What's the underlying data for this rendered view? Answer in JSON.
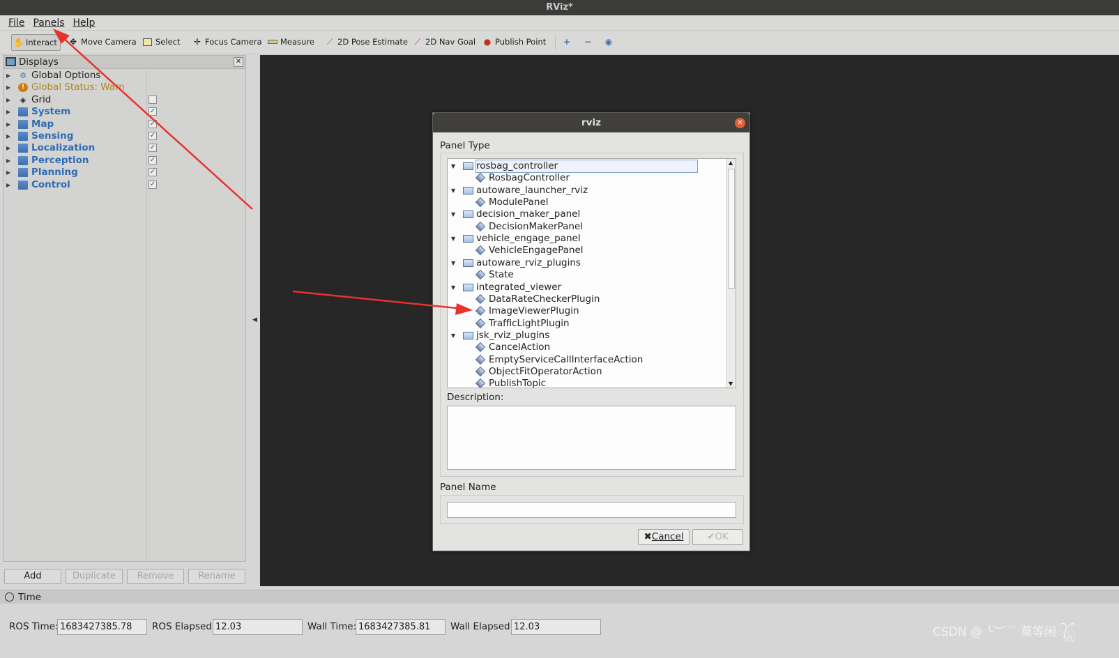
{
  "window": {
    "title": "RViz*"
  },
  "menu": [
    "File",
    "Panels",
    "Help"
  ],
  "toolbar": {
    "tools": [
      {
        "label": "Interact",
        "icon": "hand-icon",
        "active": true
      },
      {
        "label": "Move Camera",
        "icon": "move-camera-icon"
      },
      {
        "label": "Select",
        "icon": "select-icon"
      },
      {
        "label": "Focus Camera",
        "icon": "focus-camera-icon"
      },
      {
        "label": "Measure",
        "icon": "measure-icon"
      },
      {
        "label": "2D Pose Estimate",
        "icon": "pose-estimate-icon"
      },
      {
        "label": "2D Nav Goal",
        "icon": "nav-goal-icon"
      },
      {
        "label": "Publish Point",
        "icon": "publish-point-icon"
      }
    ]
  },
  "displays": {
    "title": "Displays",
    "items": [
      {
        "label": "Global Options",
        "icon": "gear-icon",
        "style": "normal",
        "checkbox": null
      },
      {
        "label": "Global Status: Warn",
        "icon": "warning-icon",
        "style": "warn",
        "checkbox": null
      },
      {
        "label": "Grid",
        "icon": "grid-icon",
        "style": "normal",
        "checkbox": "unchecked"
      },
      {
        "label": "System",
        "icon": "folder-icon",
        "style": "group",
        "checkbox": "checked"
      },
      {
        "label": "Map",
        "icon": "folder-icon",
        "style": "group",
        "checkbox": "checked"
      },
      {
        "label": "Sensing",
        "icon": "folder-icon",
        "style": "group",
        "checkbox": "checked"
      },
      {
        "label": "Localization",
        "icon": "folder-icon",
        "style": "group",
        "checkbox": "checked"
      },
      {
        "label": "Perception",
        "icon": "folder-icon",
        "style": "group",
        "checkbox": "checked"
      },
      {
        "label": "Planning",
        "icon": "folder-icon",
        "style": "group",
        "checkbox": "checked"
      },
      {
        "label": "Control",
        "icon": "folder-icon",
        "style": "group",
        "checkbox": "checked"
      }
    ],
    "buttons": {
      "add": "Add",
      "duplicate": "Duplicate",
      "remove": "Remove",
      "rename": "Rename"
    }
  },
  "time_panel": {
    "title": "Time",
    "ros_time_label": "ROS Time:",
    "ros_time": "1683427385.78",
    "ros_elapsed_label": "ROS Elapsed:",
    "ros_elapsed": "12.03",
    "wall_time_label": "Wall Time:",
    "wall_time": "1683427385.81",
    "wall_elapsed_label": "Wall Elapsed:",
    "wall_elapsed": "12.03"
  },
  "dialog": {
    "title": "rviz",
    "panel_type_label": "Panel Type",
    "tree": [
      {
        "label": "rosbag_controller",
        "kind": "package",
        "selected": true
      },
      {
        "label": "RosbagController",
        "kind": "plugin"
      },
      {
        "label": "autoware_launcher_rviz",
        "kind": "package"
      },
      {
        "label": "ModulePanel",
        "kind": "plugin"
      },
      {
        "label": "decision_maker_panel",
        "kind": "package"
      },
      {
        "label": "DecisionMakerPanel",
        "kind": "plugin"
      },
      {
        "label": "vehicle_engage_panel",
        "kind": "package"
      },
      {
        "label": "VehicleEngagePanel",
        "kind": "plugin"
      },
      {
        "label": "autoware_rviz_plugins",
        "kind": "package"
      },
      {
        "label": "State",
        "kind": "plugin"
      },
      {
        "label": "integrated_viewer",
        "kind": "package"
      },
      {
        "label": "DataRateCheckerPlugin",
        "kind": "plugin"
      },
      {
        "label": "ImageViewerPlugin",
        "kind": "plugin"
      },
      {
        "label": "TrafficLightPlugin",
        "kind": "plugin"
      },
      {
        "label": "jsk_rviz_plugins",
        "kind": "package"
      },
      {
        "label": "CancelAction",
        "kind": "plugin"
      },
      {
        "label": "EmptyServiceCallInterfaceAction",
        "kind": "plugin"
      },
      {
        "label": "ObjectFitOperatorAction",
        "kind": "plugin"
      },
      {
        "label": "PublishTopic",
        "kind": "plugin"
      }
    ],
    "description_label": "Description:",
    "description": "",
    "panel_name_label": "Panel Name",
    "panel_name": "",
    "cancel_label": "Cancel",
    "ok_label": "OK"
  },
  "watermark": "CSDN @ ╰︶﹉ 莫等闲᭄ᬼ",
  "colors": {
    "annotation_arrow": "#e8322b",
    "group_label": "#2f6bb5",
    "warn_label": "#b08a1e",
    "dialog_title_bg": "#403f3c"
  }
}
